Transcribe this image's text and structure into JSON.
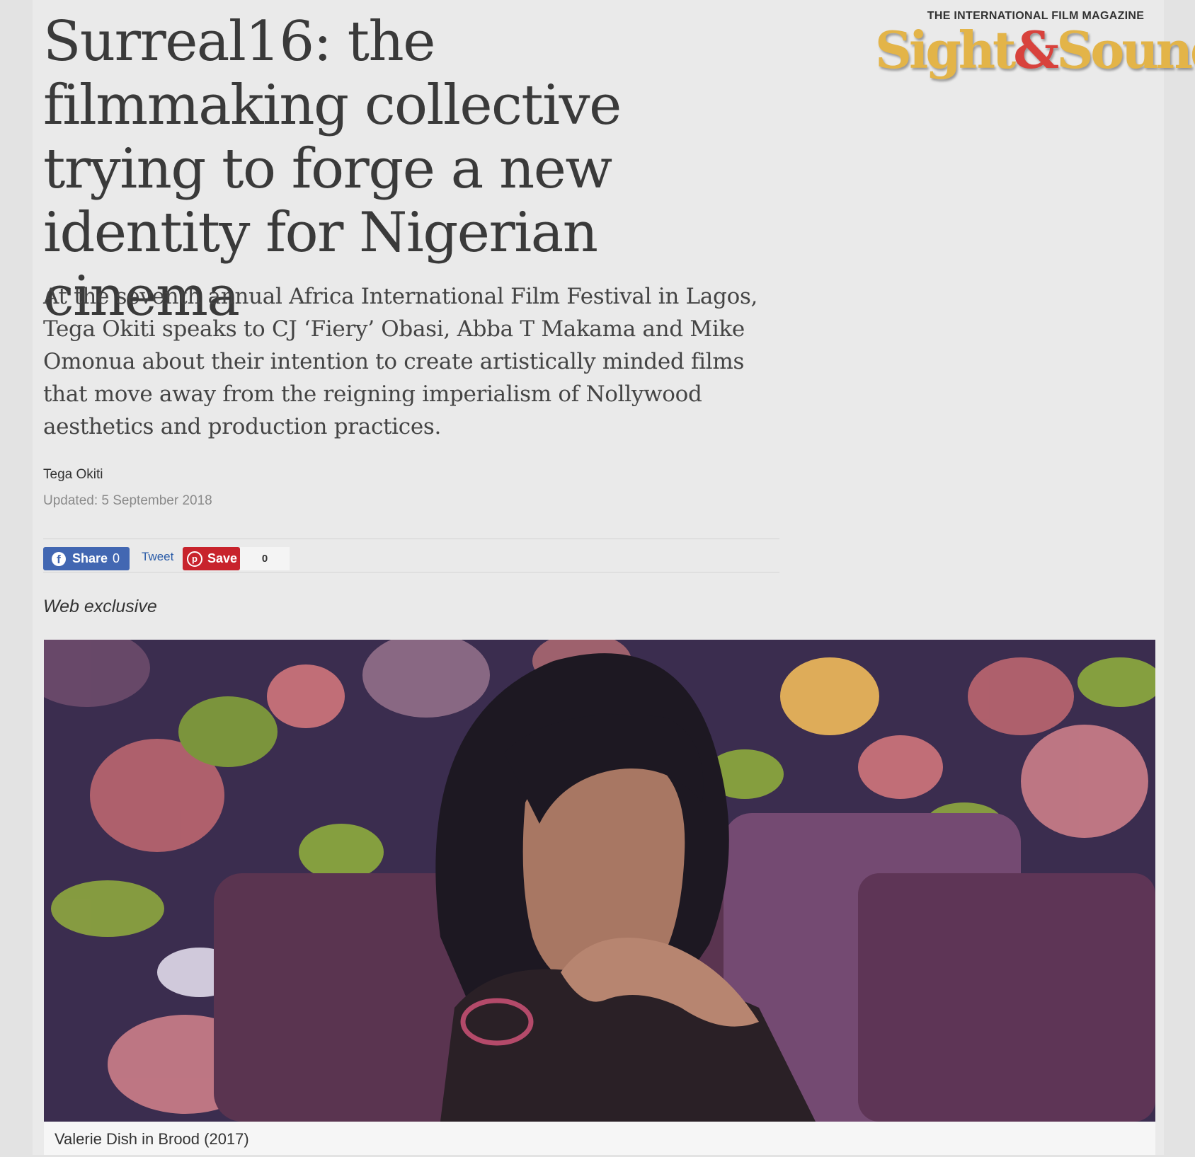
{
  "article": {
    "title": "Surreal16: the filmmaking collective trying to forge a new identity for Nigerian cinema",
    "standfirst": "At the seventh annual Africa International Film Festival in Lagos, Tega Okiti speaks to CJ ‘Fiery’ Obasi, Abba T Makama and Mike Omonua about their intention to create artistically minded films that move away from the reigning imperialism of Nollywood aesthetics and production practices.",
    "author": "Tega Okiti",
    "updated": "Updated: 5 September 2018",
    "label": "Web exclusive",
    "image_caption": "Valerie Dish in Brood (2017)"
  },
  "share": {
    "facebook_label": "Share",
    "facebook_count": "0",
    "tweet_label": "Tweet",
    "pinterest_label": "Save",
    "pinterest_count": "0"
  },
  "brand": {
    "kicker": "THE INTERNATIONAL FILM MAGAZINE",
    "logo_part1": "Sight",
    "logo_amp": "&",
    "logo_part2": "Sound"
  },
  "colors": {
    "facebook": "#4267b2",
    "pinterest": "#c8232c",
    "logo_gold": "#e3b448",
    "logo_red": "#d8423c"
  }
}
